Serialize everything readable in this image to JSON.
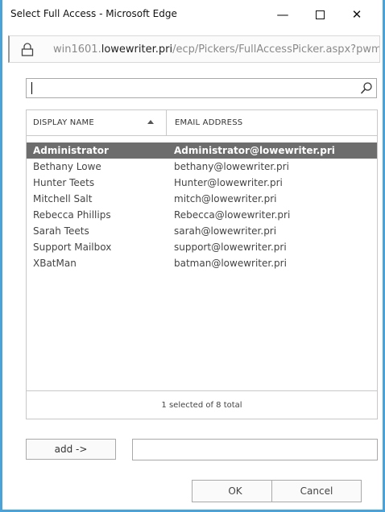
{
  "window": {
    "title": "Select Full Access - Microsoft Edge",
    "minimize_glyph": "—",
    "close_glyph": "✕"
  },
  "address": {
    "prefix": "win1601.",
    "host": "lowewriter.pri",
    "path": "/ecp/Pickers/FullAccessPicker.aspx?pwmcid="
  },
  "search": {
    "value": "",
    "placeholder": ""
  },
  "grid": {
    "columns": {
      "name": "DISPLAY NAME",
      "email": "EMAIL ADDRESS"
    },
    "rows": [
      {
        "name": "Administrator",
        "email": "Administrator@lowewriter.pri",
        "selected": true
      },
      {
        "name": "Bethany Lowe",
        "email": "bethany@lowewriter.pri",
        "selected": false
      },
      {
        "name": "Hunter Teets",
        "email": "Hunter@lowewriter.pri",
        "selected": false
      },
      {
        "name": "Mitchell Salt",
        "email": "mitch@lowewriter.pri",
        "selected": false
      },
      {
        "name": "Rebecca Phillips",
        "email": "Rebecca@lowewriter.pri",
        "selected": false
      },
      {
        "name": "Sarah Teets",
        "email": "sarah@lowewriter.pri",
        "selected": false
      },
      {
        "name": "Support Mailbox",
        "email": "support@lowewriter.pri",
        "selected": false
      },
      {
        "name": "XBatMan",
        "email": "batman@lowewriter.pri",
        "selected": false
      }
    ],
    "footer": "1 selected of 8 total"
  },
  "add": {
    "button_label": "add ->",
    "field_value": ""
  },
  "buttons": {
    "ok": "OK",
    "cancel": "Cancel"
  },
  "colors": {
    "window_border": "#4aa3d8",
    "selected_row": "#6d6d6d"
  },
  "icons": {
    "lock": "lock-icon",
    "search": "search-icon"
  }
}
